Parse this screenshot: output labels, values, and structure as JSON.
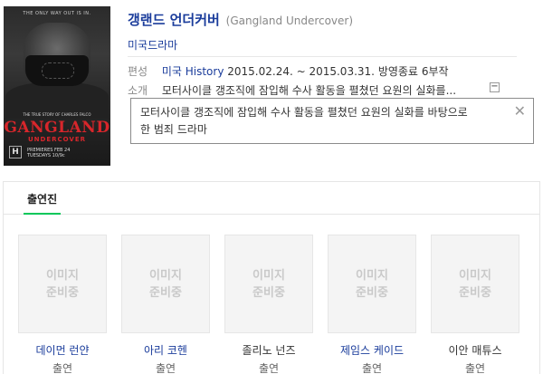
{
  "poster": {
    "tagline": "THE ONLY WAY OUT IS IN.",
    "subtitle_small": "THE TRUE STORY OF CHARLES FALCO",
    "title_line1": "GANGLAND",
    "title_line2": "UNDERCOVER",
    "network_logo": "H",
    "premiere_line1": "PREMIERES FEB 24",
    "premiere_line2": "TUESDAYS 10/9c"
  },
  "title": {
    "main": "갱랜드 언더커버",
    "original": "(Gangland Undercover)"
  },
  "genre": "미국드라마",
  "info": {
    "schedule_label": "편성",
    "broadcaster": "미국 History",
    "date_range": "2015.02.24. ~ 2015.03.31.",
    "status": "방영종료",
    "episodes": "6부작",
    "synopsis_label": "소개",
    "synopsis_short": "모터사이클 갱조직에 잠입해 수사 활동을 펼쳤던 요원의 실화를..."
  },
  "tooltip": {
    "text_line1": "모터사이클 갱조직에 잠입해 수사 활동을 펼쳤던 요원의 실화를 바탕으로",
    "text_line2": "한 범죄 드라마",
    "close": "✕"
  },
  "cast": {
    "tab": "출연진",
    "placeholder": "이미지\n준비중",
    "members": [
      {
        "name": "데이먼 런얀",
        "role": "출연",
        "linked": true
      },
      {
        "name": "아리 코헨",
        "role": "출연",
        "linked": true
      },
      {
        "name": "졸리노 넌즈",
        "role": "출연",
        "linked": false
      },
      {
        "name": "제임스 케이드",
        "role": "출연",
        "linked": true
      },
      {
        "name": "이안 매튜스",
        "role": "출연",
        "linked": false
      }
    ]
  },
  "collapse_symbol": "−"
}
